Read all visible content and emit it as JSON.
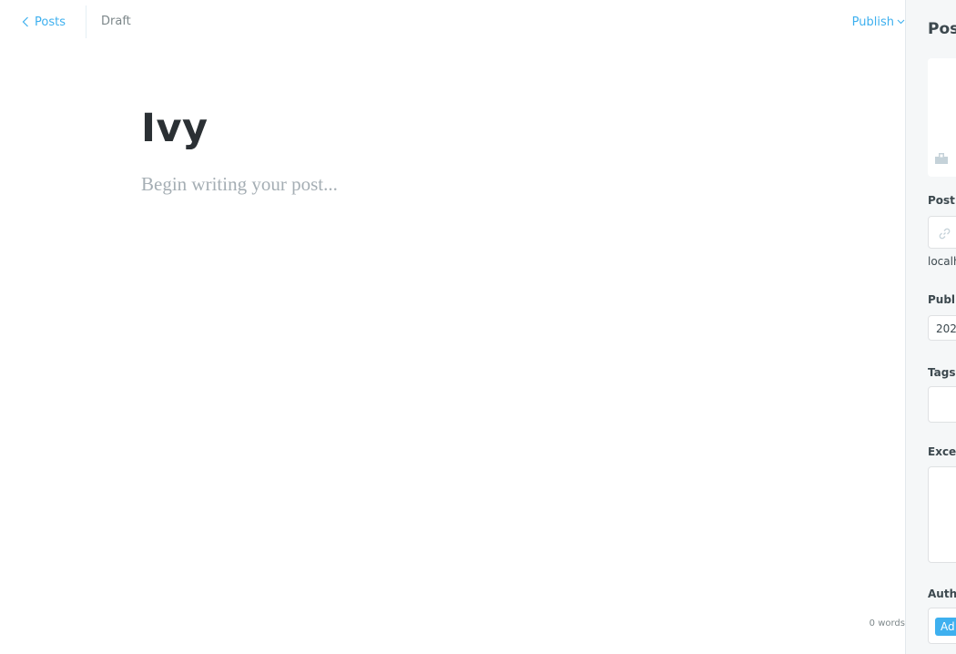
{
  "header": {
    "back_label": "Posts",
    "status": "Draft",
    "publish_label": "Publish"
  },
  "editor": {
    "title": "Ivy",
    "body_placeholder": "Begin writing your post...",
    "word_count": "0 words"
  },
  "sidebar": {
    "title": "Pos",
    "post_url_label": "Post",
    "url_preview": "localh",
    "publish_date_label": "Publi",
    "publish_date_value": "202",
    "tags_label": "Tags",
    "excerpt_label": "Excer",
    "authors_label": "Auth",
    "author_chip": "Ad"
  },
  "colors": {
    "accent": "#3eb0ef",
    "text_dark": "#2b3034",
    "muted": "#7d878a",
    "placeholder": "#a5aeb4",
    "sidebar_bg": "#f5f7f8"
  }
}
